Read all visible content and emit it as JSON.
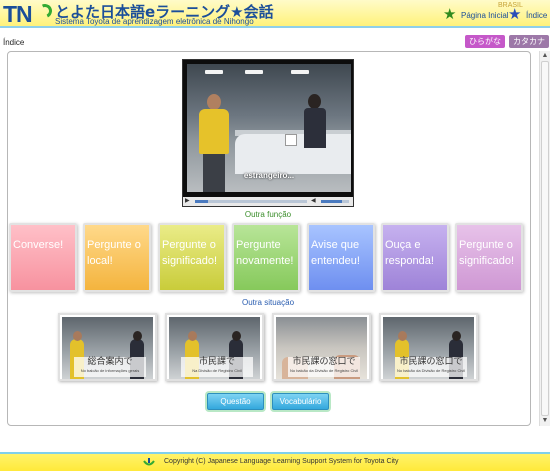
{
  "header": {
    "logo_tn": "TN",
    "logo_title": "とよた日本語eラーニング★会話",
    "logo_subtitle": "Sistema Toyota de aprendizagem eletrônica de Nihongo",
    "corner_label": "BRASIL",
    "home_link": "Página Inicial",
    "index_link": "Índice"
  },
  "breadcrumb": "Índice",
  "kana": {
    "hiragana": "ひらがな",
    "katakana": "カタカナ"
  },
  "video": {
    "subtitle": "estrangeiro...",
    "progress": 0.12,
    "volume": 0.75
  },
  "sections": {
    "functions_label": "Outra função",
    "situations_label": "Outra situação"
  },
  "functions": [
    {
      "label": "Converse!",
      "color_top": "#ffc0c8",
      "color_bottom": "#f7929f"
    },
    {
      "label": "Pergunte o local!",
      "color_top": "#ffd98a",
      "color_bottom": "#f4b43e"
    },
    {
      "label": "Pergunte o significado!",
      "color_top": "#eaec88",
      "color_bottom": "#c9cc3a"
    },
    {
      "label": "Pergunte novamente!",
      "color_top": "#b8e598",
      "color_bottom": "#86c95b"
    },
    {
      "label": "Avise que entendeu!",
      "color_top": "#a8c4ff",
      "color_bottom": "#6e8ff0"
    },
    {
      "label": "Ouça e responda!",
      "color_top": "#c6b1ef",
      "color_bottom": "#9e83d8"
    },
    {
      "label": "Pergunte o significado!",
      "color_top": "#e7c2e9",
      "color_bottom": "#cf98d4"
    }
  ],
  "situations": [
    {
      "jp": "総合案内で",
      "pt": "No balcão de informações gerais"
    },
    {
      "jp": "市民課で",
      "pt": "Na Divisão de Registro Civil"
    },
    {
      "jp": "市民課の窓口で",
      "pt": "No balcão da Divisão de Registro Civil"
    },
    {
      "jp": "市民課の窓口で",
      "pt": "No balcão da Divisão de Registro Civil"
    }
  ],
  "buttons": {
    "questao": "Questão",
    "vocabulario": "Vocabulário"
  },
  "footer": {
    "copyright": "Copyright (C) Japanese Language Learning Support System for Toyota City"
  }
}
